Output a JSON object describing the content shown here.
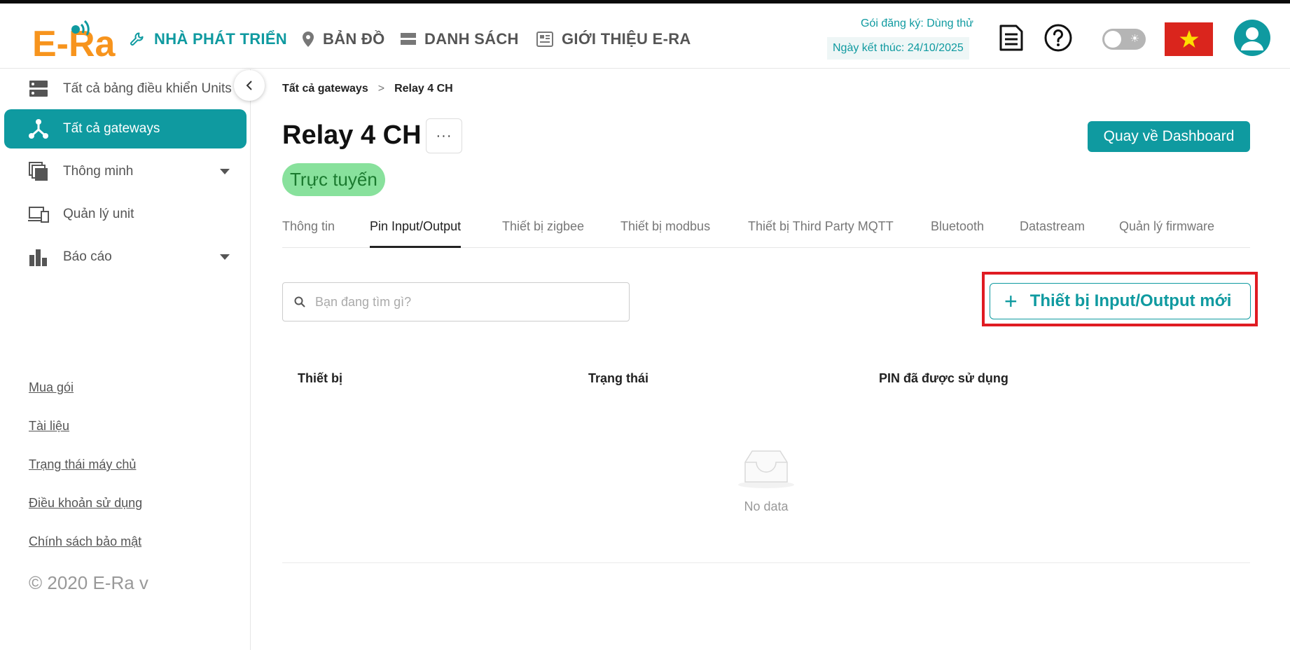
{
  "header": {
    "logo_text": "E-Ra",
    "nav": [
      {
        "label": "NHÀ PHÁT TRIỂN",
        "icon": "wrench-icon",
        "active": true
      },
      {
        "label": "BẢN ĐỒ",
        "icon": "map-pin-icon",
        "active": false
      },
      {
        "label": "DANH SÁCH",
        "icon": "list-icon",
        "active": false
      },
      {
        "label": "GIỚI THIỆU E-RA",
        "icon": "newspaper-icon",
        "active": false
      }
    ],
    "subscription_plan": "Gói đăng ký: Dùng thử",
    "subscription_end": "Ngày kết thúc: 24/10/2025",
    "icons": [
      "document-icon",
      "help-icon",
      "theme-toggle",
      "vietnam-flag-icon",
      "user-avatar-icon"
    ]
  },
  "sidebar": {
    "items": [
      {
        "label": "Tất cả bảng điều khiển Units",
        "icon": "server-icon",
        "active": false,
        "has_caret": false
      },
      {
        "label": "Tất cả gateways",
        "icon": "gateway-icon",
        "active": true,
        "has_caret": false
      },
      {
        "label": "Thông minh",
        "icon": "layers-icon",
        "active": false,
        "has_caret": true
      },
      {
        "label": "Quản lý unit",
        "icon": "devices-icon",
        "active": false,
        "has_caret": false
      },
      {
        "label": "Báo cáo",
        "icon": "bar-chart-icon",
        "active": false,
        "has_caret": true
      }
    ],
    "links": [
      "Mua gói",
      "Tài liệu",
      "Trạng thái máy chủ",
      "Điều khoản sử dụng",
      "Chính sách bảo mật"
    ],
    "copyright": "© 2020 E-Ra v"
  },
  "main": {
    "breadcrumb": {
      "root": "Tất cả gateways",
      "separator": ">",
      "current": "Relay 4 CH"
    },
    "title": "Relay 4 CH",
    "more_label": "···",
    "status": "Trực tuyến",
    "dashboard_button": "Quay về Dashboard",
    "tabs": [
      {
        "label": "Thông tin",
        "active": false
      },
      {
        "label": "Pin Input/Output",
        "active": true
      },
      {
        "label": "Thiết bị zigbee",
        "active": false
      },
      {
        "label": "Thiết bị modbus",
        "active": false
      },
      {
        "label": "Thiết bị Third Party MQTT",
        "active": false
      },
      {
        "label": "Bluetooth",
        "active": false
      },
      {
        "label": "Datastream",
        "active": false
      },
      {
        "label": "Quản lý firmware",
        "active": false
      }
    ],
    "search_placeholder": "Bạn đang tìm gì?",
    "new_button_label": "Thiết bị Input/Output mới",
    "table": {
      "columns": [
        "Thiết bị",
        "Trạng thái",
        "PIN đã được sử dụng"
      ],
      "rows": [],
      "empty_text": "No data"
    }
  },
  "colors": {
    "primary": "#0f9aa0",
    "logo_orange": "#f7941d",
    "status_bg": "#88e19c",
    "status_text": "#1b7a2f",
    "highlight": "#e01b22",
    "flag_red": "#da251d",
    "flag_star": "#ffde00"
  }
}
